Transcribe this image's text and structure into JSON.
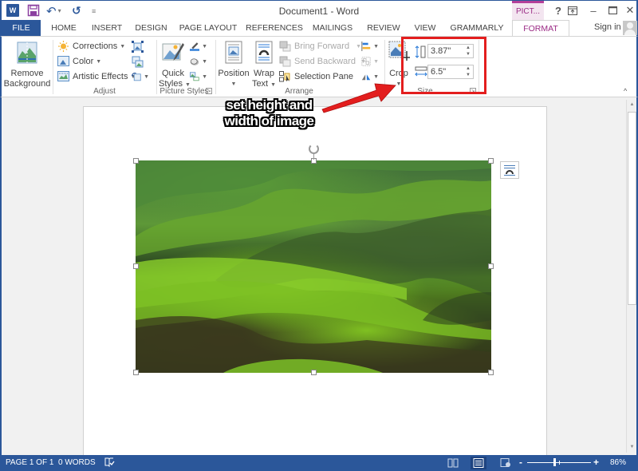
{
  "window": {
    "title": "Document1 - Word",
    "context_tab_group": "PICT...",
    "controls": {
      "help": "?",
      "ribbon_display": "⊡",
      "minimize": "–",
      "maximize": "☐",
      "close": "✕"
    }
  },
  "quick_access": {
    "app_icon": "W",
    "undo_glyph": "↶",
    "undo_caret": "▾",
    "redo_glyph": "↺",
    "customize_glyph": "≡"
  },
  "tabs": [
    {
      "label": "FILE"
    },
    {
      "label": "HOME"
    },
    {
      "label": "INSERT"
    },
    {
      "label": "DESIGN"
    },
    {
      "label": "PAGE LAYOUT"
    },
    {
      "label": "REFERENCES"
    },
    {
      "label": "MAILINGS"
    },
    {
      "label": "REVIEW"
    },
    {
      "label": "VIEW"
    },
    {
      "label": "GRAMMARLY"
    },
    {
      "label": "FORMAT",
      "active": true
    }
  ],
  "account": {
    "sign_in": "Sign in"
  },
  "ribbon": {
    "adjust": {
      "label": "Adjust",
      "remove_background": [
        "Remove",
        "Background"
      ],
      "corrections": "Corrections",
      "color": "Color",
      "artistic_effects": "Artistic Effects"
    },
    "picture_styles": {
      "label": "Picture Styles",
      "quick_styles": [
        "Quick",
        "Styles"
      ]
    },
    "arrange": {
      "label": "Arrange",
      "position": "Position",
      "wrap_text": [
        "Wrap",
        "Text"
      ],
      "bring_forward": "Bring Forward",
      "send_backward": "Send Backward",
      "selection_pane": "Selection Pane"
    },
    "crop": {
      "label": "Crop"
    },
    "size": {
      "label": "Size",
      "height": "3.87\"",
      "width": "6.5\""
    },
    "collapse_glyph": "^"
  },
  "annotation": {
    "line1": "set height and",
    "line2": "width of image",
    "highlight_color": "#e31e1e"
  },
  "statusbar": {
    "page": "PAGE 1 OF 1",
    "words": "0 WORDS",
    "zoom_minus": "-",
    "zoom_plus": "+",
    "zoom_level": "86%",
    "zoom_percent": 86
  },
  "colors": {
    "word_blue": "#2b579a",
    "context_magenta": "#9b2b85",
    "ribbon_border": "#d4d4d4"
  }
}
